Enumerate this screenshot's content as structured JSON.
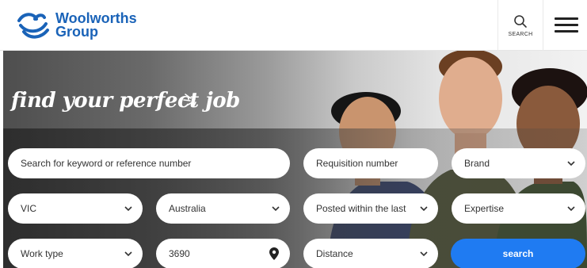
{
  "brand": {
    "line1": "Woolworths",
    "line2": "Group",
    "color": "#1a63b8"
  },
  "header": {
    "search_label": "SEARCH",
    "search_icon": "magnifier",
    "menu_icon": "hamburger"
  },
  "hero": {
    "headline": "find your perfect job"
  },
  "form": {
    "keyword_placeholder": "Search for keyword or reference number",
    "requisition_placeholder": "Requisition number",
    "brand_select": "Brand",
    "state_select": "VIC",
    "country_select": "Australia",
    "posted_select": "Posted within the last",
    "expertise_select": "Expertise",
    "worktype_select": "Work type",
    "postcode_value": "3690",
    "distance_select": "Distance",
    "search_button": "search"
  },
  "colors": {
    "accent": "#1f7bf2"
  }
}
